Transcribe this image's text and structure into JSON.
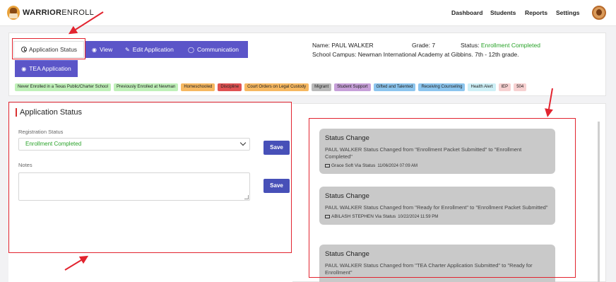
{
  "brand": {
    "name_bold": "WARRIOR",
    "name_light": "ENROLL"
  },
  "nav": [
    "Dashboard",
    "Students",
    "Reports",
    "Settings"
  ],
  "tabs": {
    "status": "Application Status",
    "view": "View",
    "edit": "Edit Application",
    "communication": "Communication",
    "tea": "TEA Application"
  },
  "student": {
    "name_label": "Name:",
    "name": "PAUL WALKER",
    "grade_label": "Grade:",
    "grade": "7",
    "status_label": "Status:",
    "status": "Enrollment Completed",
    "campus_label": "School Campus:",
    "campus": "Newman International Academy at Gibbins. 7th - 12th grade."
  },
  "tags": [
    {
      "label": "Never Enrolled in a Texas Public/Charter School",
      "color": "#bff0b8"
    },
    {
      "label": "Previously Enrolled at Newman",
      "color": "#bff0b8"
    },
    {
      "label": "Homeschooled",
      "color": "#f6b861"
    },
    {
      "label": "Discipline",
      "color": "#e05252"
    },
    {
      "label": "Court Orders on Legal Custody",
      "color": "#f6b861"
    },
    {
      "label": "Migrant",
      "color": "#b9b9b9"
    },
    {
      "label": "Student Support",
      "color": "#c7a0d9"
    },
    {
      "label": "Gifted and Talented",
      "color": "#8cc5ee"
    },
    {
      "label": "Receiving Counseling",
      "color": "#8cc5ee"
    },
    {
      "label": "Health Alert",
      "color": "#cdeff6"
    },
    {
      "label": "IEP",
      "color": "#f7d1d1"
    },
    {
      "label": "504",
      "color": "#f7d1d1"
    }
  ],
  "form": {
    "title": "Application Status",
    "registration_label": "Registration Status",
    "registration_value": "Enrollment Completed",
    "notes_label": "Notes",
    "notes_value": "",
    "save_label": "Save"
  },
  "timeline": [
    {
      "title": "Status Change",
      "body": "PAUL WALKER Status Changed from \"Enrollment Packet Submitted\" to \"Enrollment Completed\"",
      "author": "Grace Soft Via Status",
      "time": "11/06/2024 07:09 AM"
    },
    {
      "title": "Status Change",
      "body": "PAUL WALKER Status Changed from \"Ready for Enrollment\" to \"Enrollment Packet Submitted\"",
      "author": "ABILASH STEPHEN Via Status",
      "time": "10/22/2024 11:59 PM"
    },
    {
      "title": "Status Change",
      "body": "PAUL WALKER Status Changed from \"TEA Charter Application Submitted\" to \"Ready for Enrollment\"",
      "author": "",
      "time": ""
    }
  ]
}
